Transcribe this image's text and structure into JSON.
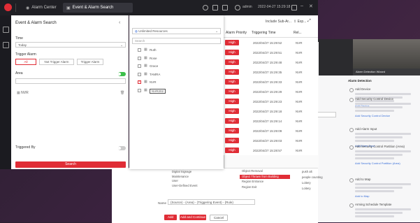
{
  "topbar": {
    "tabs": [
      "Alarm Center",
      "Event & Alarm Search"
    ],
    "user": "admin",
    "datetime": "2022-04-27 15:29:18"
  },
  "search_panel": {
    "title": "Event & Alarm Search",
    "time_label": "Time",
    "time_value": "Today",
    "trigger_label": "Trigger Alarm",
    "trigger_options": [
      "All",
      "Not Trigger Alarm",
      "Trigger Alarm"
    ],
    "area_label": "Area",
    "area_item": "NVR",
    "triggered_by_label": "Triggered By",
    "search_button": "Search"
  },
  "dropdown": {
    "selector_text": "Unlimited Resources",
    "include_label": "Include Sub-Ar...",
    "search_placeholder": "Search",
    "items": [
      {
        "label": "Ruth",
        "checked": false
      },
      {
        "label": "Rose",
        "checked": false
      },
      {
        "label": "Grace",
        "checked": false
      },
      {
        "label": "TAMRA",
        "checked": false
      },
      {
        "label": "NVR",
        "checked": true
      },
      {
        "label": "NVR202",
        "checked": false
      }
    ]
  },
  "results": {
    "columns": [
      "Alarm Priority",
      "Triggering Time",
      "Rel..."
    ],
    "export_label": "Exp...",
    "priority": "High",
    "source": "NVR",
    "rows": [
      "2022/04/27 15:29:52",
      "2022/04/27 15:29:51",
      "2022/04/27 15:29:48",
      "2022/04/27 15:29:35",
      "2022/04/27 15:29:33",
      "2022/04/27 15:29:29",
      "2022/04/27 15:29:23",
      "2022/04/27 15:29:18",
      "2022/04/27 15:29:14",
      "2022/04/27 15:29:09",
      "2022/04/27 15:29:03",
      "2022/04/27 15:28:57"
    ]
  },
  "right_window": {
    "header": "Alarm Detection Wizard",
    "section": "Alarm Detection",
    "items": [
      {
        "title": "Add Device",
        "link": "Add Device"
      },
      {
        "title": "Add Security Control Device",
        "link": "Add Security Control Device"
      },
      {
        "title": "Add Alarm Input",
        "link": "Add Alarm Input"
      },
      {
        "title": "Add Security Control Partition (Area)",
        "link": "Add Security Control Partition (Area)"
      },
      {
        "title": "Add to Map",
        "link": "Add to Map"
      },
      {
        "title": "Arming Schedule Template",
        "link": ""
      }
    ]
  },
  "bottom_dialog": {
    "tree_items": [
      "Digital Signage",
      "Maintenance",
      "User",
      "User-Defined Event"
    ],
    "mid_items": [
      "Object Removal",
      "Object Thrown from Building",
      "Region Entrance",
      "Region Exit"
    ],
    "right_items": [
      "push alt",
      "people counting",
      "Loitery",
      "Loitery"
    ],
    "name_label": "Name",
    "name_value": "(Source) - (Area) - (Triggering Event) - (Rule)",
    "buttons": [
      "Add",
      "Add and Continue",
      "Cancel"
    ]
  }
}
